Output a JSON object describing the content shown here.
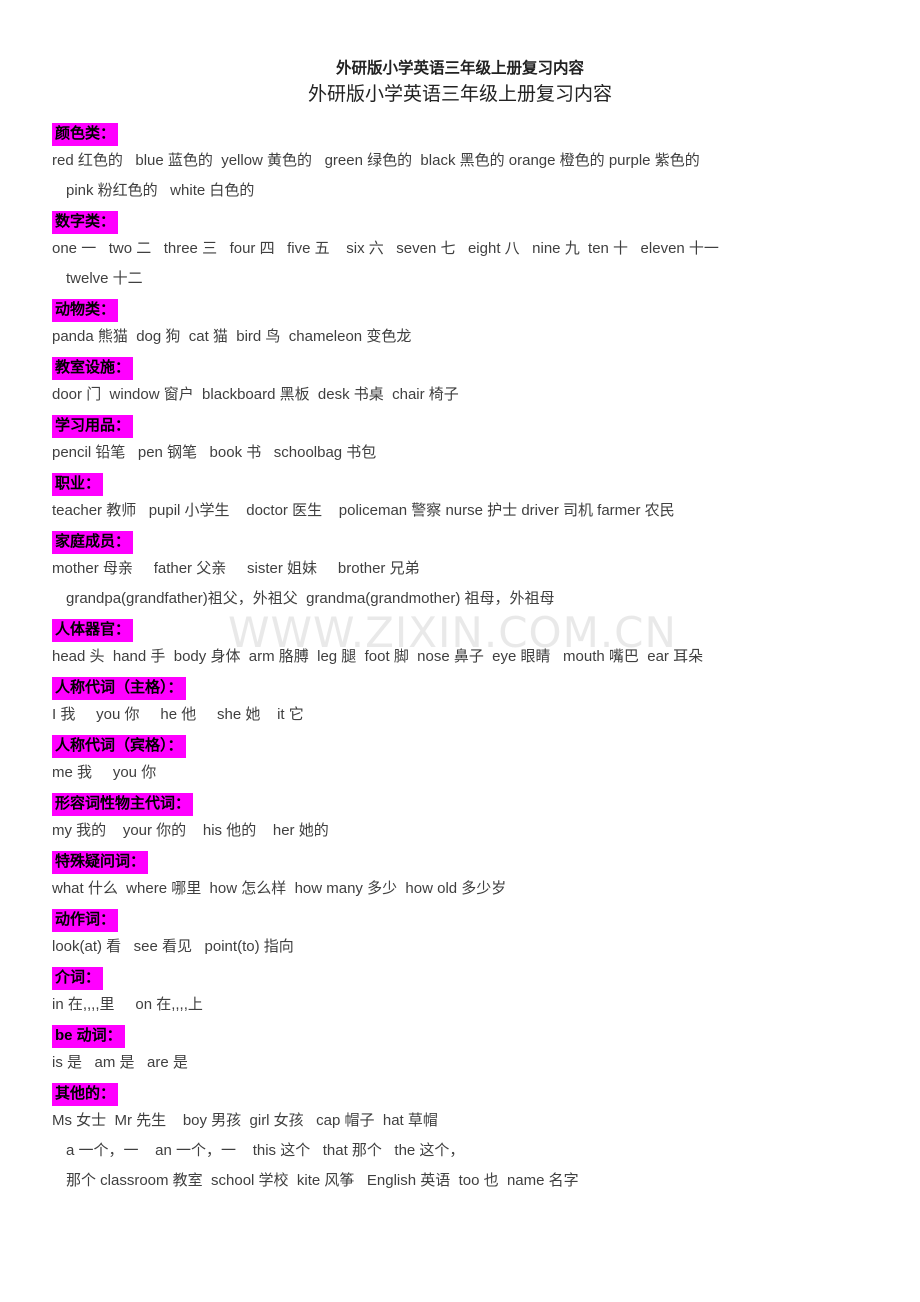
{
  "document": {
    "title_bold": "外研版小学英语三年级上册复习内容",
    "title_serif": "外研版小学英语三年级上册复习内容",
    "watermark": "WWW.ZIXIN.COM.CN",
    "highlight_color": "#FF00FF",
    "text_color": "#3f3f3f"
  },
  "sections": [
    {
      "heading": "颜色类：",
      "lines": [
        "red 红色的   blue 蓝色的  yellow 黄色的   green 绿色的  black 黑色的 orange 橙色的 purple 紫色的",
        "pink 粉红色的   white 白色的"
      ]
    },
    {
      "heading": "数字类：",
      "lines": [
        "one 一   two 二   three 三   four 四   five 五    six 六   seven 七   eight 八   nine 九  ten 十   eleven 十一",
        "twelve 十二"
      ]
    },
    {
      "heading": "动物类：",
      "lines": [
        "panda 熊猫  dog 狗  cat 猫  bird 鸟  chameleon 变色龙"
      ]
    },
    {
      "heading": "教室设施：",
      "lines": [
        "door 门  window 窗户  blackboard 黑板  desk 书桌  chair 椅子"
      ]
    },
    {
      "heading": "学习用品：",
      "lines": [
        "pencil 铅笔   pen 钢笔   book 书   schoolbag 书包"
      ]
    },
    {
      "heading": "职业：",
      "lines": [
        "teacher 教师   pupil 小学生    doctor 医生    policeman 警察 nurse 护士 driver 司机 farmer 农民"
      ]
    },
    {
      "heading": "家庭成员：",
      "lines": [
        "mother 母亲     father 父亲     sister 姐妹     brother 兄弟",
        "grandpa(grandfather)祖父，外祖父  grandma(grandmother) 祖母，外祖母"
      ]
    },
    {
      "heading": "人体器官：",
      "lines": [
        "head 头  hand 手  body 身体  arm 胳膊  leg 腿  foot 脚  nose 鼻子  eye 眼睛   mouth 嘴巴  ear 耳朵"
      ]
    },
    {
      "heading": "人称代词（主格）：",
      "lines": [
        "I 我     you 你     he 他     she 她    it 它"
      ]
    },
    {
      "heading": "人称代词（宾格）：",
      "lines": [
        "me 我     you 你"
      ]
    },
    {
      "heading": "形容词性物主代词：",
      "lines": [
        "my 我的    your 你的    his 他的    her 她的"
      ]
    },
    {
      "heading": "特殊疑问词：",
      "lines": [
        "what 什么  where 哪里  how 怎么样  how many 多少  how old 多少岁"
      ]
    },
    {
      "heading": "动作词：",
      "lines": [
        "look(at) 看   see 看见   point(to) 指向"
      ]
    },
    {
      "heading": "介词：",
      "lines": [
        "in 在,,,,里     on 在,,,,上"
      ]
    },
    {
      "heading": "be 动词：",
      "lines": [
        "is 是   am 是   are 是"
      ]
    },
    {
      "heading": "其他的：",
      "lines": [
        "Ms 女士  Mr 先生    boy 男孩  girl 女孩   cap 帽子  hat 草帽",
        "a 一个，一    an 一个，一    this 这个   that 那个   the 这个，",
        "那个 classroom 教室  school 学校  kite 风筝   English 英语  too 也  name 名字"
      ]
    }
  ]
}
